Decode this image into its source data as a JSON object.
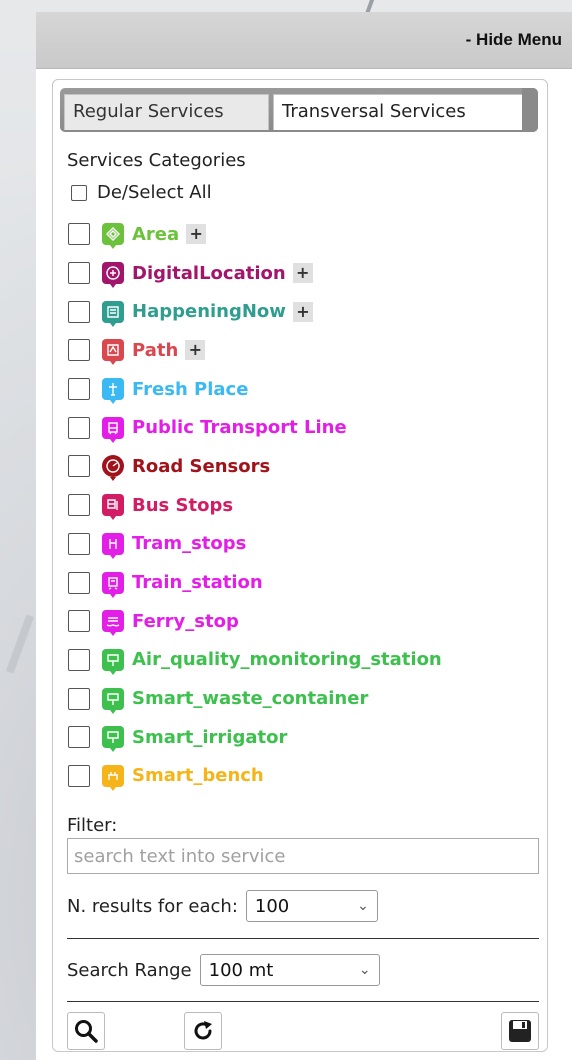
{
  "header": {
    "hide_menu_label": "- Hide Menu"
  },
  "tabs": [
    {
      "label": "Regular Services"
    },
    {
      "label": "Transversal Services"
    }
  ],
  "categories_title": "Services Categories",
  "select_all_label": "De/Select All",
  "services": [
    {
      "label": "Area",
      "color": "#6dc23d",
      "icon": "area-icon",
      "expandable": true
    },
    {
      "label": "DigitalLocation",
      "color": "#a3156a",
      "icon": "digital-location-icon",
      "expandable": true
    },
    {
      "label": "HappeningNow",
      "color": "#2f9e91",
      "icon": "happening-now-icon",
      "expandable": true
    },
    {
      "label": "Path",
      "color": "#d9474f",
      "icon": "path-icon",
      "expandable": true
    },
    {
      "label": "Fresh Place",
      "color": "#3ab9f3",
      "icon": "fresh-place-icon",
      "expandable": false
    },
    {
      "label": "Public Transport Line",
      "color": "#e31ee6",
      "icon": "public-transport-line-icon",
      "expandable": false
    },
    {
      "label": "Road Sensors",
      "color": "#a0131b",
      "icon": "road-sensors-icon",
      "expandable": false
    },
    {
      "label": "Bus Stops",
      "color": "#d21c63",
      "icon": "bus-stops-icon",
      "expandable": false
    },
    {
      "label": "Tram_stops",
      "color": "#e31ee6",
      "icon": "tram-stops-icon",
      "expandable": false
    },
    {
      "label": "Train_station",
      "color": "#e31ee6",
      "icon": "train-station-icon",
      "expandable": false
    },
    {
      "label": "Ferry_stop",
      "color": "#e31ee6",
      "icon": "ferry-stop-icon",
      "expandable": false
    },
    {
      "label": "Air_quality_monitoring_station",
      "color": "#3ec04e",
      "icon": "air-quality-icon",
      "expandable": false
    },
    {
      "label": "Smart_waste_container",
      "color": "#3ec04e",
      "icon": "smart-waste-icon",
      "expandable": false
    },
    {
      "label": "Smart_irrigator",
      "color": "#3ec04e",
      "icon": "smart-irrigator-icon",
      "expandable": false
    },
    {
      "label": "Smart_bench",
      "color": "#f4b41a",
      "icon": "smart-bench-icon",
      "expandable": false
    }
  ],
  "plus_symbol": "+",
  "filter": {
    "label": "Filter:",
    "placeholder": "search text into service",
    "value": ""
  },
  "results": {
    "label": "N. results for each:",
    "value": "100"
  },
  "search_range": {
    "label": "Search Range",
    "value": "100 mt"
  },
  "actions": [
    {
      "icon": "search-icon"
    },
    {
      "icon": "refresh-icon"
    },
    {
      "icon": "save-icon"
    }
  ]
}
